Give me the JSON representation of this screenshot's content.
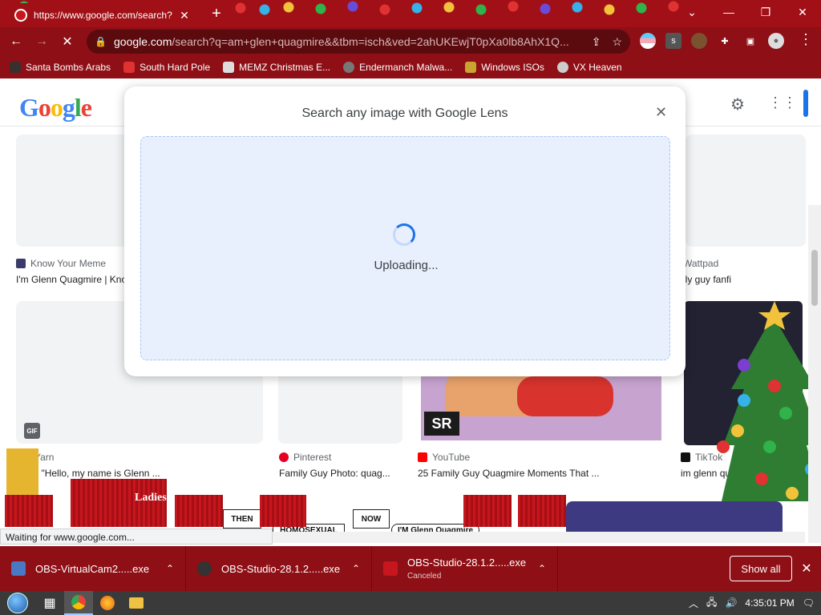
{
  "browser": {
    "tab_title": "https://www.google.com/search?",
    "new_tab": "+",
    "url_domain": "google.com",
    "url_path": "/search?q=am+glen+quagmire&&tbm=isch&ved=2ahUKEwjT0pXa0lb8AhX1Q...",
    "window_controls": [
      "⌄",
      "—",
      "❐",
      "✕"
    ]
  },
  "bookmarks": [
    {
      "label": "Santa Bombs Arabs",
      "color": "#3a2f2f"
    },
    {
      "label": "South Hard Pole",
      "color": "#e03232"
    },
    {
      "label": "MEMZ Christmas E...",
      "color": "#dddddd"
    },
    {
      "label": "Endermanch Malwa...",
      "color": "#777777"
    },
    {
      "label": "Windows ISOs",
      "color": "#c9a431"
    },
    {
      "label": "VX Heaven",
      "color": "#cccccc"
    }
  ],
  "google": {
    "logo": [
      "G",
      "o",
      "o",
      "g",
      "l",
      "e"
    ]
  },
  "results": [
    {
      "source": "Know Your Meme",
      "caption": "I'm Glenn Quagmire | Kno",
      "icon_color": "#3b3b6b"
    },
    {
      "source": "Wattpad",
      "caption": "ily guy fanfi",
      "icon_color": "#ff6122"
    },
    {
      "source": "etYarn",
      "caption": "| \"Hello, my name is Glenn ...",
      "icon_color": "#999999"
    },
    {
      "source": "Pinterest",
      "caption": "Family Guy Photo: quag...",
      "icon_color": "#e60023"
    },
    {
      "source": "YouTube",
      "caption": "25 Family Guy Quagmire Moments That ...",
      "icon_color": "#ff0000"
    },
    {
      "source": "TikTok",
      "caption": "im glenn quagmire mem...",
      "icon_color": "#111111"
    }
  ],
  "gif_badge": "GIF",
  "lens": {
    "title": "Search any image with Google Lens",
    "status": "Uploading..."
  },
  "yt_badge": "SR",
  "overlay_labels": {
    "ladies": "Ladies",
    "then": "THEN",
    "now": "NOW",
    "homosexual": "HOMOSEXUAL",
    "im_glenn": "I'M Glenn Quagmire"
  },
  "status_text": "Waiting for www.google.com...",
  "downloads": [
    {
      "name": "OBS-VirtualCam2.....exe",
      "sub": "",
      "icon_color": "#4a78c2"
    },
    {
      "name": "OBS-Studio-28.1.2.....exe",
      "sub": "",
      "icon_color": "#333333"
    },
    {
      "name": "OBS-Studio-28.1.2.....exe",
      "sub": "Canceled",
      "icon_color": "#c7161d"
    }
  ],
  "show_all": "Show all",
  "clock": "4:35:01 PM"
}
